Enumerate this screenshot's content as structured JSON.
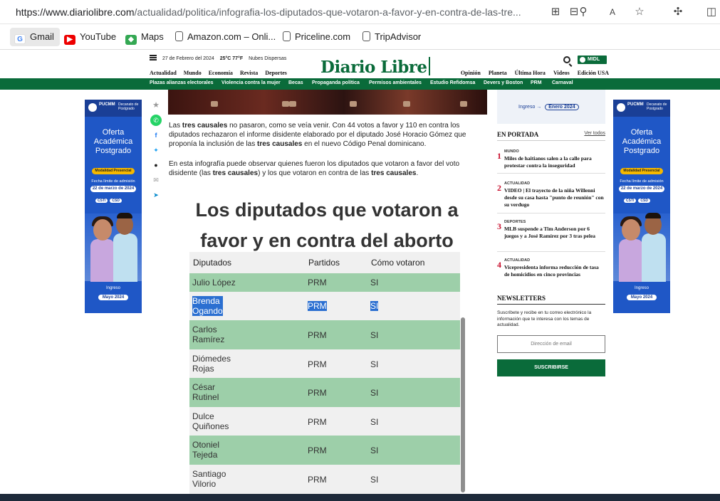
{
  "browser": {
    "url_prefix": "https://www.diariolibre.com",
    "url_rest": "/actualidad/politica/infografia-los-diputados-que-votaron-a-favor-y-en-contra-de-las-tre...",
    "bookmarks": [
      {
        "label": "Gmail",
        "icon": "gmail-icon"
      },
      {
        "label": "YouTube",
        "icon": "youtube-icon"
      },
      {
        "label": "Maps",
        "icon": "maps-icon"
      },
      {
        "label": "Amazon.com – Onli...",
        "icon": "page-icon"
      },
      {
        "label": "Priceline.com",
        "icon": "page-icon"
      },
      {
        "label": "TripAdvisor",
        "icon": "page-icon"
      }
    ]
  },
  "site": {
    "date": "27 de Febrero del 2024",
    "temp": "25°C 77°F",
    "weather": "Nubes Dispersas",
    "logo": "Diario Libre",
    "account_label": "MIDL",
    "nav_left": [
      "Actualidad",
      "Mundo",
      "Economía",
      "Revista",
      "Deportes"
    ],
    "nav_right": [
      "Opinión",
      "Planeta",
      "Última Hora",
      "Videos",
      "Edición USA"
    ],
    "trending": [
      "Plazas alianzas electorales",
      "Violencia contra la mujer",
      "Becas",
      "Propaganda política",
      "Permisos ambientales",
      "Estudio Refidomsa",
      "Devers y Boston",
      "PRM",
      "Carnaval"
    ]
  },
  "ad": {
    "brand": "PUCMM",
    "brand_sub": "Decanato de Postgrado",
    "headline1": "Oferta",
    "headline2": "Académica",
    "headline3": "Postgrado",
    "modalidad": "Modalidad Presencial",
    "deadline_label": "Fecha límite de admisión",
    "deadline": "22 de marzo de 2024",
    "chip1": "CSTI",
    "chip2": "CSD",
    "ingreso": "Ingreso",
    "ingreso_date": "Mayo 2024"
  },
  "article": {
    "p1_a": "Las ",
    "p1_b": "tres causales",
    "p1_c": " no pasaron, como se veía venir. Con 44 votos a favor y 110 en contra los diputados rechazaron el informe disidente elaborado por el diputado José Horacio Gómez que proponía la inclusión de las ",
    "p1_d": "tres causales",
    "p1_e": " en el nuevo Código Penal dominicano.",
    "p2_a": "En esta infografía puede observar quienes fueron los diputados que votaron a favor del voto disidente (las ",
    "p2_b": "tres causales",
    "p2_c": ") y los que votaron en contra de las ",
    "p2_d": "tres causales",
    "p2_e": ".",
    "info_title_1": "Los diputados que votaron a",
    "info_title_2": "favor y en contra del aborto",
    "columns": [
      "Diputados",
      "Partidos",
      "Cómo votaron"
    ],
    "rows": [
      {
        "name": "Julio López",
        "party": "PRM",
        "vote": "SI"
      },
      {
        "name": "Brenda Ogando",
        "name1": "Brenda",
        "name2": "Ogando",
        "party": "PRM",
        "vote": "SI"
      },
      {
        "name1": "Carlos",
        "name2": "Ramírez",
        "party": "PRM",
        "vote": "SI"
      },
      {
        "name1": "Diómedes",
        "name2": "Rojas",
        "party": "PRM",
        "vote": "SI"
      },
      {
        "name1": "César",
        "name2": "Rutinel",
        "party": "PRM",
        "vote": "SI"
      },
      {
        "name1": "Dulce",
        "name2": "Quiñones",
        "party": "PRM",
        "vote": "SI"
      },
      {
        "name1": "Otoniel",
        "name2": "Tejeda",
        "party": "PRM",
        "vote": "SI"
      },
      {
        "name1": "Santiago",
        "name2": "Vilorio",
        "party": "PRM",
        "vote": "SI"
      }
    ]
  },
  "sidebar": {
    "promo_text": "Ingreso",
    "promo_date": "Enero 2024",
    "portada_title": "EN PORTADA",
    "ver_todos": "Ver todos",
    "news": [
      {
        "num": "1",
        "cat": "MUNDO",
        "title": "Miles de haitianos salen a la calle para protestar contra la inseguridad"
      },
      {
        "num": "2",
        "cat": "ACTUALIDAD",
        "title": "VIDEO | El trayecto de la niña Willenni desde su casa hasta \"punto de reunión\" con su verdugo"
      },
      {
        "num": "3",
        "cat": "DEPORTES",
        "title": "MLB suspende a Tim Anderson por 6 juegos y a José Ramírez por 3 tras pelea"
      },
      {
        "num": "4",
        "cat": "ACTUALIDAD",
        "title": "Vicepresidenta informa reducción de tasa de homicidios en cinco provincias"
      }
    ],
    "newsletter_title": "NEWSLETTERS",
    "newsletter_desc": "Suscríbete y recibe en tu correo electrónico la información que te interesa con los temas de actualidad.",
    "email_placeholder": "Dirección de email",
    "subscribe": "SUSCRIBIRSE"
  }
}
